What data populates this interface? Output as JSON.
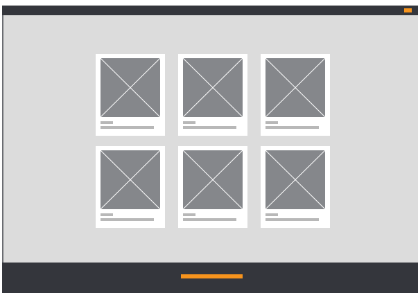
{
  "colors": {
    "accent": "#f7941d",
    "chrome": "#34363c",
    "canvas": "#dcdcdc",
    "card": "#ffffff",
    "placeholder_fill": "#85878b",
    "placeholder_stroke": "#ffffff",
    "text_placeholder": "#b8b8b8"
  },
  "gallery": {
    "cards": [
      {
        "icon": "image-placeholder-icon"
      },
      {
        "icon": "image-placeholder-icon"
      },
      {
        "icon": "image-placeholder-icon"
      },
      {
        "icon": "image-placeholder-icon"
      },
      {
        "icon": "image-placeholder-icon"
      },
      {
        "icon": "image-placeholder-icon"
      }
    ]
  }
}
